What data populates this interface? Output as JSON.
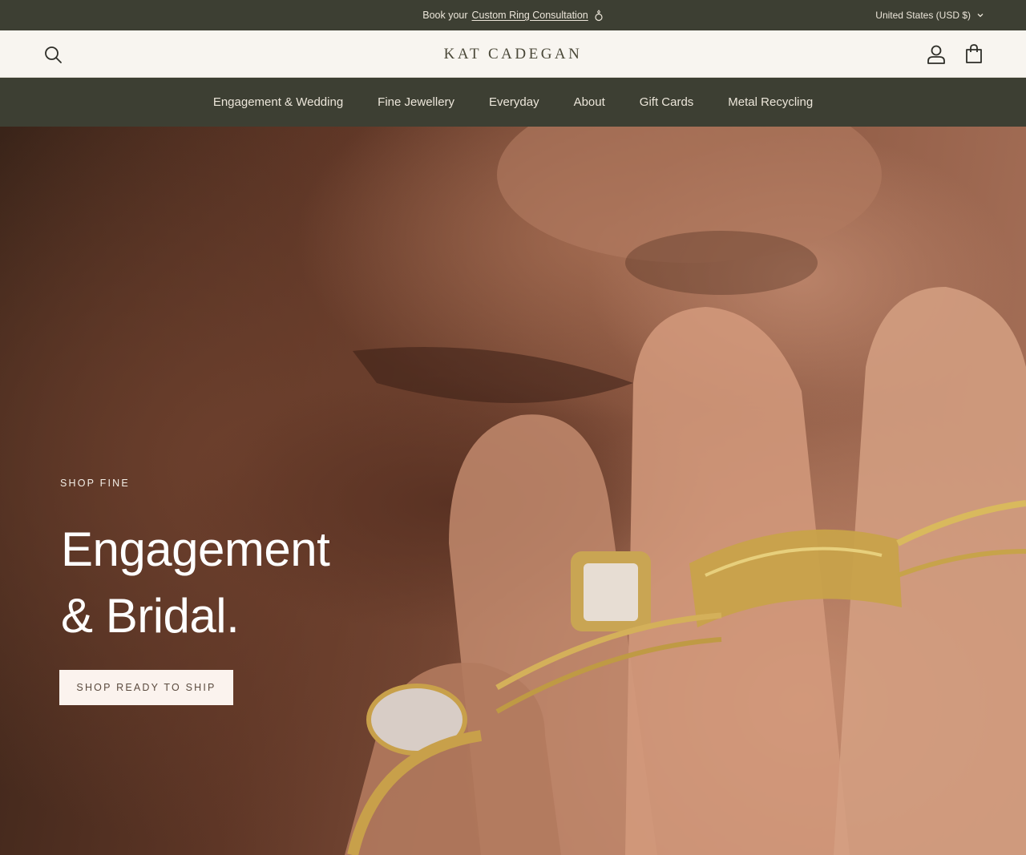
{
  "announcement": {
    "prefix": "Book your",
    "link_text": "Custom Ring Consultation",
    "icon": "ring-icon",
    "country_selector": "United States (USD $)"
  },
  "header": {
    "logo": "KAT CADEGAN",
    "icons": [
      "search-icon",
      "account-icon",
      "cart-icon"
    ]
  },
  "nav": {
    "items": [
      {
        "label": "Engagement & Wedding"
      },
      {
        "label": "Fine Jewellery"
      },
      {
        "label": "Everyday"
      },
      {
        "label": "About"
      },
      {
        "label": "Gift Cards"
      },
      {
        "label": "Metal Recycling"
      }
    ]
  },
  "hero": {
    "kicker": "SHOP FINE",
    "title_line1": "Engagement",
    "title_line2": "& Bridal.",
    "cta": "SHOP READY TO SHIP"
  },
  "colors": {
    "bar_bg": "#3d3f33",
    "bar_text": "#ece6da",
    "header_bg": "#f8f5f0",
    "logo": "#4a4838",
    "cta_bg": "#fbf3ee"
  }
}
